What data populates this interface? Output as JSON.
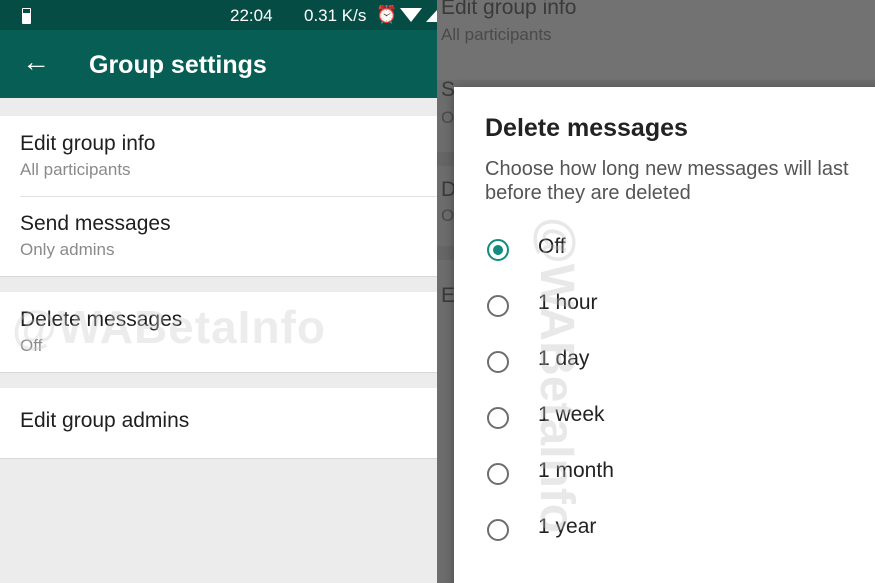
{
  "status_bar": {
    "time": "22:04",
    "speed": "0.31 K/s"
  },
  "app_bar": {
    "title": "Group settings"
  },
  "settings": [
    {
      "primary": "Edit group info",
      "secondary": "All participants"
    },
    {
      "primary": "Send messages",
      "secondary": "Only admins"
    },
    {
      "primary": "Delete messages",
      "secondary": "Off"
    },
    {
      "primary": "Edit group admins"
    }
  ],
  "watermark": "@WABetaInfo",
  "background_right": {
    "row1_primary": "Edit group info",
    "row1_secondary": "All participants",
    "row2_primary": "S",
    "row2_secondary": "O",
    "row3_primary": "D",
    "row3_secondary": "O",
    "row4_primary": "E"
  },
  "dialog": {
    "title": "Delete messages",
    "description": "Choose how long new messages will last before they are deleted",
    "options": [
      {
        "label": "Off",
        "selected": true
      },
      {
        "label": "1 hour",
        "selected": false
      },
      {
        "label": "1 day",
        "selected": false
      },
      {
        "label": "1 week",
        "selected": false
      },
      {
        "label": "1 month",
        "selected": false
      },
      {
        "label": "1 year",
        "selected": false
      }
    ]
  },
  "colors": {
    "app_bar": "#075e54",
    "status_bar": "#054d44",
    "accent": "#118c7e"
  }
}
